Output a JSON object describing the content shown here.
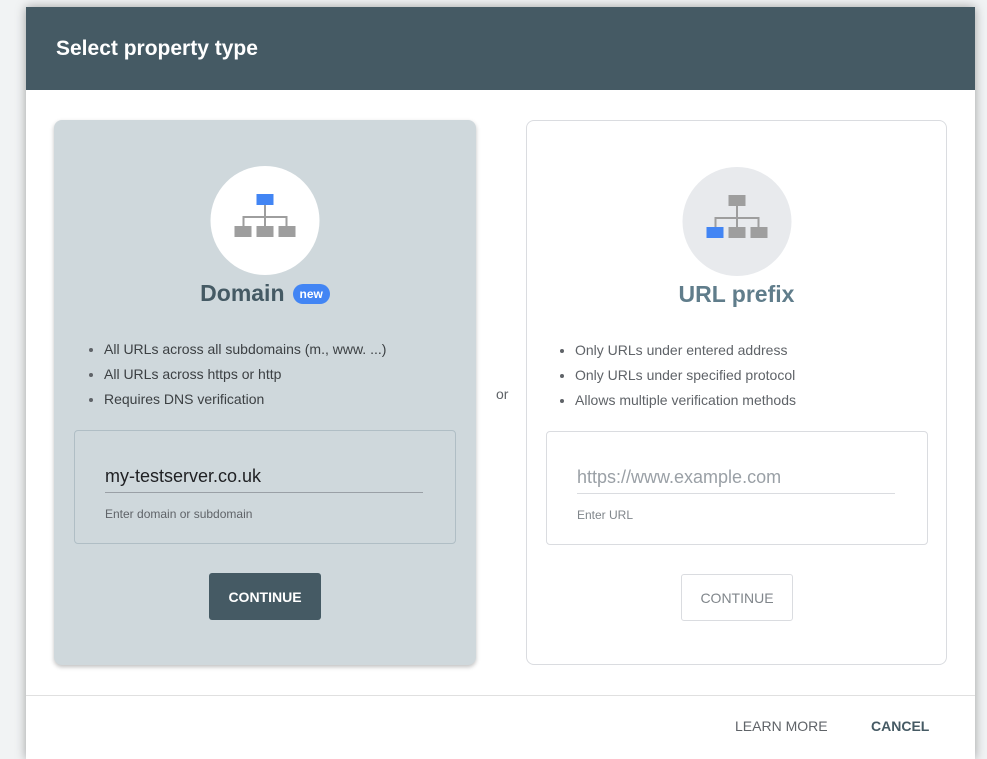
{
  "dialog": {
    "title": "Select property type"
  },
  "domain_card": {
    "title": "Domain",
    "badge": "new",
    "features": [
      "All URLs across all subdomains (m., www. ...)",
      "All URLs across https or http",
      "Requires DNS verification"
    ],
    "input": {
      "value": "my-testserver.co.uk",
      "helper": "Enter domain or subdomain"
    },
    "continue_label": "CONTINUE"
  },
  "separator": "or",
  "url_card": {
    "title": "URL prefix",
    "features": [
      "Only URLs under entered address",
      "Only URLs under specified protocol",
      "Allows multiple verification methods"
    ],
    "input": {
      "placeholder": "https://www.example.com",
      "helper": "Enter URL"
    },
    "continue_label": "CONTINUE"
  },
  "footer": {
    "learn_more_label": "LEARN MORE",
    "cancel_label": "CANCEL"
  },
  "colors": {
    "header": "#455a64",
    "accent_blue": "#4285f4",
    "domain_card_bg": "#cfd8dc"
  },
  "icons": [
    "sitemap-icon"
  ]
}
